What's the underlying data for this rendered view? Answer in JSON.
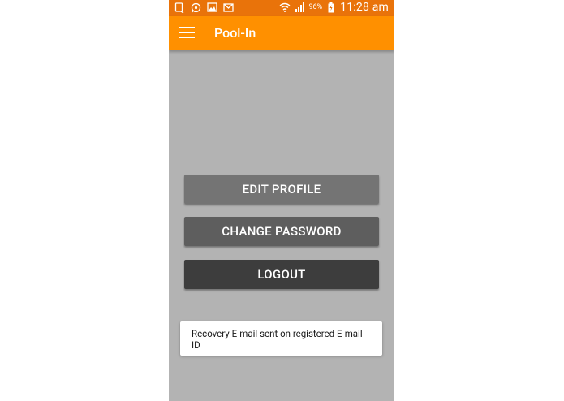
{
  "status_bar": {
    "battery": "96%",
    "time": "11:28 am",
    "background": "#e9730a",
    "icons": [
      "notification-icon",
      "whatsapp-icon",
      "image-icon",
      "gmail-icon",
      "wifi-icon",
      "signal-icon",
      "battery-icon"
    ]
  },
  "app_bar": {
    "title": "Pool-In",
    "background": "#ff9000",
    "menu_icon": "hamburger-menu-icon"
  },
  "content_background": "#b3b3b3",
  "buttons": {
    "edit_profile": "EDIT PROFILE",
    "change_password": "CHANGE PASSWORD",
    "logout": "LOGOUT"
  },
  "toast": {
    "message": "Recovery E-mail sent on registered E-mail ID"
  }
}
